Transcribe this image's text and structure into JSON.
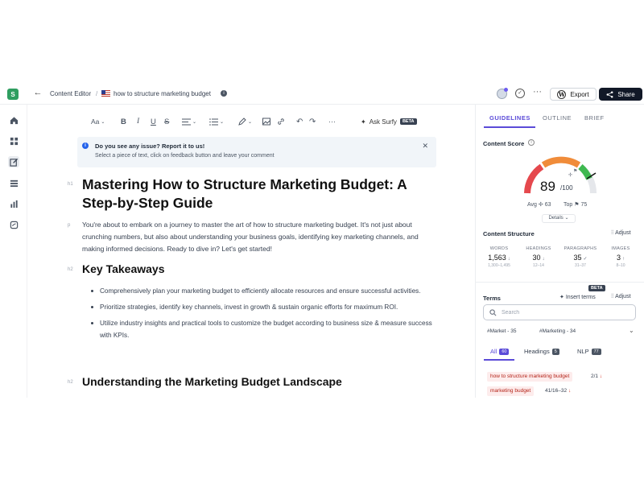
{
  "header": {
    "logo_letter": "S",
    "breadcrumb_root": "Content Editor",
    "breadcrumb_sep": "/",
    "doc_title": "how to structure marketing budget",
    "export_label": "Export",
    "share_label": "Share"
  },
  "toolbar": {
    "font_label": "Aa",
    "bold": "B",
    "italic": "I",
    "underline": "U",
    "strike": "S",
    "ask_surfy_label": "Ask Surfy",
    "beta": "BETA"
  },
  "notice": {
    "title": "Do you see any issue? Report it to us!",
    "body": "Select a piece of text, click on feedback button and leave your comment"
  },
  "document": {
    "h1_tag": "h1",
    "title": "Mastering How to Structure Marketing Budget: A Step-by-Step Guide",
    "p_tag": "p",
    "intro": "You're about to embark on a journey to master the art of how to structure marketing budget. It's not just about crunching numbers, but also about understanding your business goals, identifying key marketing channels, and making informed decisions. Ready to dive in? Let's get started!",
    "h2_tag": "h2",
    "h2_takeaways": "Key Takeaways",
    "bullets": [
      "Comprehensively plan your marketing budget to efficiently allocate resources and ensure successful activities.",
      "Prioritize strategies, identify key channels, invest in growth & sustain organic efforts for maximum ROI.",
      "Utilize industry insights and practical tools to customize the budget according to business size & measure success with KPIs."
    ],
    "h2_landscape": "Understanding the Marketing Budget Landscape"
  },
  "panel": {
    "tabs": [
      "GUIDELINES",
      "OUTLINE",
      "BRIEF"
    ],
    "content_score_title": "Content Score",
    "score": "89",
    "score_max": "/100",
    "score_value": 89,
    "avg": "Avg ✢ 63",
    "top": "Top ⚑ 75",
    "details_label": "Details ⌄",
    "structure_title": "Content Structure",
    "adjust_label": "Adjust",
    "stats": [
      {
        "label": "WORDS",
        "value": "1,563",
        "arrow": "↓",
        "range": "1,300–1,495"
      },
      {
        "label": "HEADINGS",
        "value": "30",
        "arrow": "↓",
        "range": "12–14"
      },
      {
        "label": "PARAGRAPHS",
        "value": "35",
        "arrow": "✓",
        "range": "31–37"
      },
      {
        "label": "IMAGES",
        "value": "3",
        "arrow": "↑",
        "range": "8–10"
      }
    ],
    "terms_title": "Terms",
    "beta": "BETA",
    "insert_terms": "Insert terms",
    "search_placeholder": "Search",
    "tag1": "#Market - 35",
    "tag2": "#Marketing - 34",
    "filters": [
      {
        "label": "All",
        "count": "60"
      },
      {
        "label": "Headings",
        "count": "5"
      },
      {
        "label": "NLP",
        "count": "77"
      }
    ],
    "terms": [
      {
        "text": "how to structure marketing budget",
        "count": "2/1",
        "arrow": "↓"
      },
      {
        "text": "marketing budget",
        "count": "41/16–32",
        "arrow": "↓"
      }
    ]
  },
  "colors": {
    "accent": "#5b4bd8",
    "gauge_red": "#e5484d",
    "gauge_orange": "#f08c3a",
    "gauge_green": "#3fb950",
    "logo_green": "#2f9e60"
  }
}
